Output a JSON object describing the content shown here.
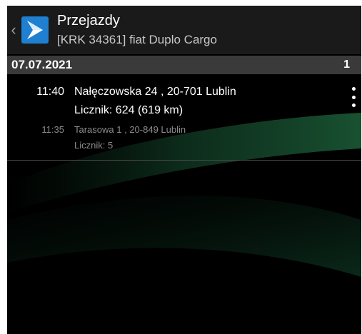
{
  "actionbar": {
    "title": "Przejazdy",
    "subtitle": "[KRK 34361] fiat Duplo Cargo",
    "back_icon": "chevron-left-icon",
    "logo_icon": "app-logo-icon"
  },
  "section": {
    "date": "07.07.2021",
    "count": "1"
  },
  "trip": {
    "end": {
      "time": "11:40",
      "address": "Nałęczowska 24 , 20-701 Lublin",
      "counter": "Licznik: 624 (619 km)"
    },
    "start": {
      "time": "11:35",
      "address": "Tarasowa 1 , 20-849 Lublin",
      "counter": "Licznik: 5"
    },
    "menu_icon": "more-vert-icon"
  },
  "colors": {
    "background": "#000000",
    "actionbar": "#1a1a1a",
    "section_header": "#3a3a3a",
    "logo_blue": "#1f7fd0",
    "swoosh_green": "#0f3d25"
  }
}
